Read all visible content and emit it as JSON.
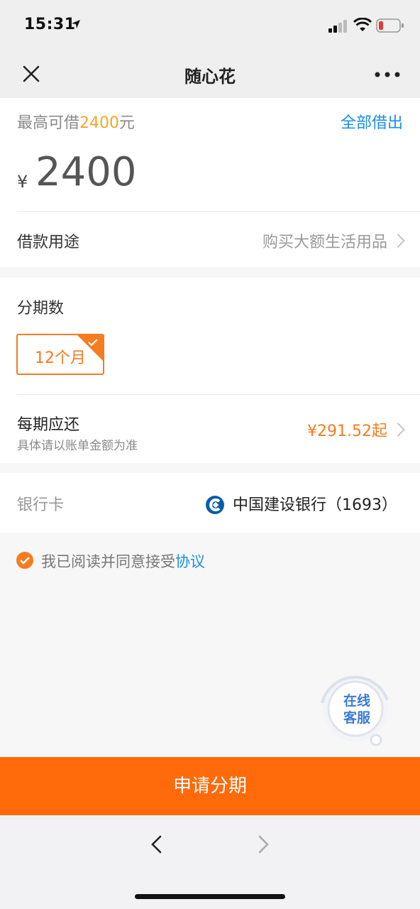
{
  "status_bar": {
    "time": "15:31"
  },
  "nav": {
    "title": "随心花"
  },
  "loan": {
    "max_prefix": "最高可借",
    "max_amount": "2400",
    "max_suffix": "元",
    "borrow_all": "全部借出",
    "currency": "¥",
    "amount": "2400"
  },
  "purpose": {
    "label": "借款用途",
    "value": "购买大额生活用品"
  },
  "installments": {
    "label": "分期数",
    "selected": "12个月"
  },
  "repayment": {
    "label": "每期应还",
    "sub": "具体请以账单金额为准",
    "value": "¥291.52起"
  },
  "bank": {
    "label": "银行卡",
    "name": "中国建设银行（1693）"
  },
  "agreement": {
    "text": "我已阅读并同意接受",
    "link": "协议"
  },
  "service": {
    "line1": "在线",
    "line2": "客服"
  },
  "apply_button": "申请分期",
  "colors": {
    "accent": "#ff6a0a",
    "link": "#1a8fe0"
  }
}
